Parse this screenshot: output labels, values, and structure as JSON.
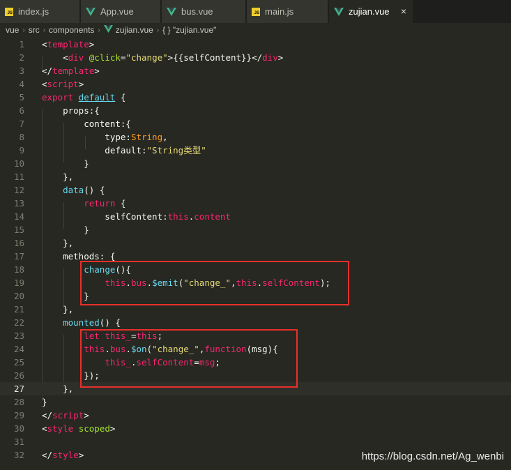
{
  "tabs": [
    {
      "label": "index.js",
      "icon": "js-icon",
      "active": false
    },
    {
      "label": "App.vue",
      "icon": "vue-icon",
      "active": false
    },
    {
      "label": "bus.vue",
      "icon": "vue-icon",
      "active": false
    },
    {
      "label": "main.js",
      "icon": "js-icon",
      "active": false
    },
    {
      "label": "zujian.vue",
      "icon": "vue-icon",
      "active": true,
      "close": "×"
    }
  ],
  "icon_text": {
    "js": "JS"
  },
  "breadcrumb": {
    "items": [
      "vue",
      "src",
      "components",
      "zujian.vue",
      "{ } \"zujian.vue\""
    ],
    "separator": "›"
  },
  "editor": {
    "current_line": 27,
    "lines": [
      {
        "n": "1"
      },
      {
        "n": "2"
      },
      {
        "n": "3"
      },
      {
        "n": "4"
      },
      {
        "n": "5"
      },
      {
        "n": "6"
      },
      {
        "n": "7"
      },
      {
        "n": "8"
      },
      {
        "n": "9"
      },
      {
        "n": "10"
      },
      {
        "n": "11"
      },
      {
        "n": "12"
      },
      {
        "n": "13"
      },
      {
        "n": "14"
      },
      {
        "n": "15"
      },
      {
        "n": "16"
      },
      {
        "n": "17"
      },
      {
        "n": "18"
      },
      {
        "n": "19"
      },
      {
        "n": "20"
      },
      {
        "n": "21"
      },
      {
        "n": "22"
      },
      {
        "n": "23"
      },
      {
        "n": "24"
      },
      {
        "n": "25"
      },
      {
        "n": "26"
      },
      {
        "n": "27"
      },
      {
        "n": "28"
      },
      {
        "n": "29"
      },
      {
        "n": "30"
      },
      {
        "n": "31"
      },
      {
        "n": "32"
      }
    ],
    "code": {
      "l1": [
        "<",
        "template",
        ">"
      ],
      "l2": [
        "    ",
        "<",
        "div",
        " ",
        "@click",
        "=",
        "\"change\"",
        ">",
        "{{selfContent}}",
        "</",
        "div",
        ">"
      ],
      "l3": [
        "</",
        "template",
        ">"
      ],
      "l4": [
        "<",
        "script",
        ">"
      ],
      "l5": [
        "export",
        " ",
        "default",
        " {"
      ],
      "l6": [
        "    props:{"
      ],
      "l7": [
        "        content:{"
      ],
      "l8": [
        "            type:",
        "String",
        ","
      ],
      "l9": [
        "            default:",
        "\"String类型\""
      ],
      "l10": [
        "        }"
      ],
      "l11": [
        "    },"
      ],
      "l12": [
        "    ",
        "data",
        "() {"
      ],
      "l13": [
        "        ",
        "return",
        " {"
      ],
      "l14": [
        "            selfContent:",
        "this",
        ".",
        "content"
      ],
      "l15": [
        "        }"
      ],
      "l16": [
        "    },"
      ],
      "l17": [
        "    methods: {"
      ],
      "l18": [
        "        ",
        "change",
        "(){"
      ],
      "l19": [
        "            ",
        "this",
        ".",
        "bus",
        ".",
        "$emit",
        "(",
        "\"change_\"",
        ",",
        "this",
        ".",
        "selfContent",
        ");"
      ],
      "l20": [
        "        }"
      ],
      "l21": [
        "    },"
      ],
      "l22": [
        "    ",
        "mounted",
        "() {"
      ],
      "l23": [
        "        ",
        "let",
        " ",
        "this_",
        "=",
        "this",
        ";"
      ],
      "l24": [
        "        ",
        "this",
        ".",
        "bus",
        ".",
        "$on",
        "(",
        "\"change_\"",
        ",",
        "function",
        "(msg){"
      ],
      "l25": [
        "            ",
        "this_",
        ".",
        "selfContent",
        "=",
        "msg",
        ";"
      ],
      "l26": [
        "        });"
      ],
      "l27": [
        "    },"
      ],
      "l28": [
        "}"
      ],
      "l29": [
        "</",
        "script",
        ">"
      ],
      "l30": [
        "<",
        "style",
        " ",
        "scoped",
        ">"
      ],
      "l31": [
        ""
      ],
      "l32": [
        "</",
        "style",
        ">"
      ]
    }
  },
  "watermark": "https://blog.csdn.net/Ag_wenbi",
  "colors": {
    "background": "#272822",
    "tag": "#f92672",
    "attr": "#a6e22e",
    "string": "#e6db74",
    "function": "#66d9ef",
    "this": "#fd971f",
    "highlight": "#e8302b"
  }
}
